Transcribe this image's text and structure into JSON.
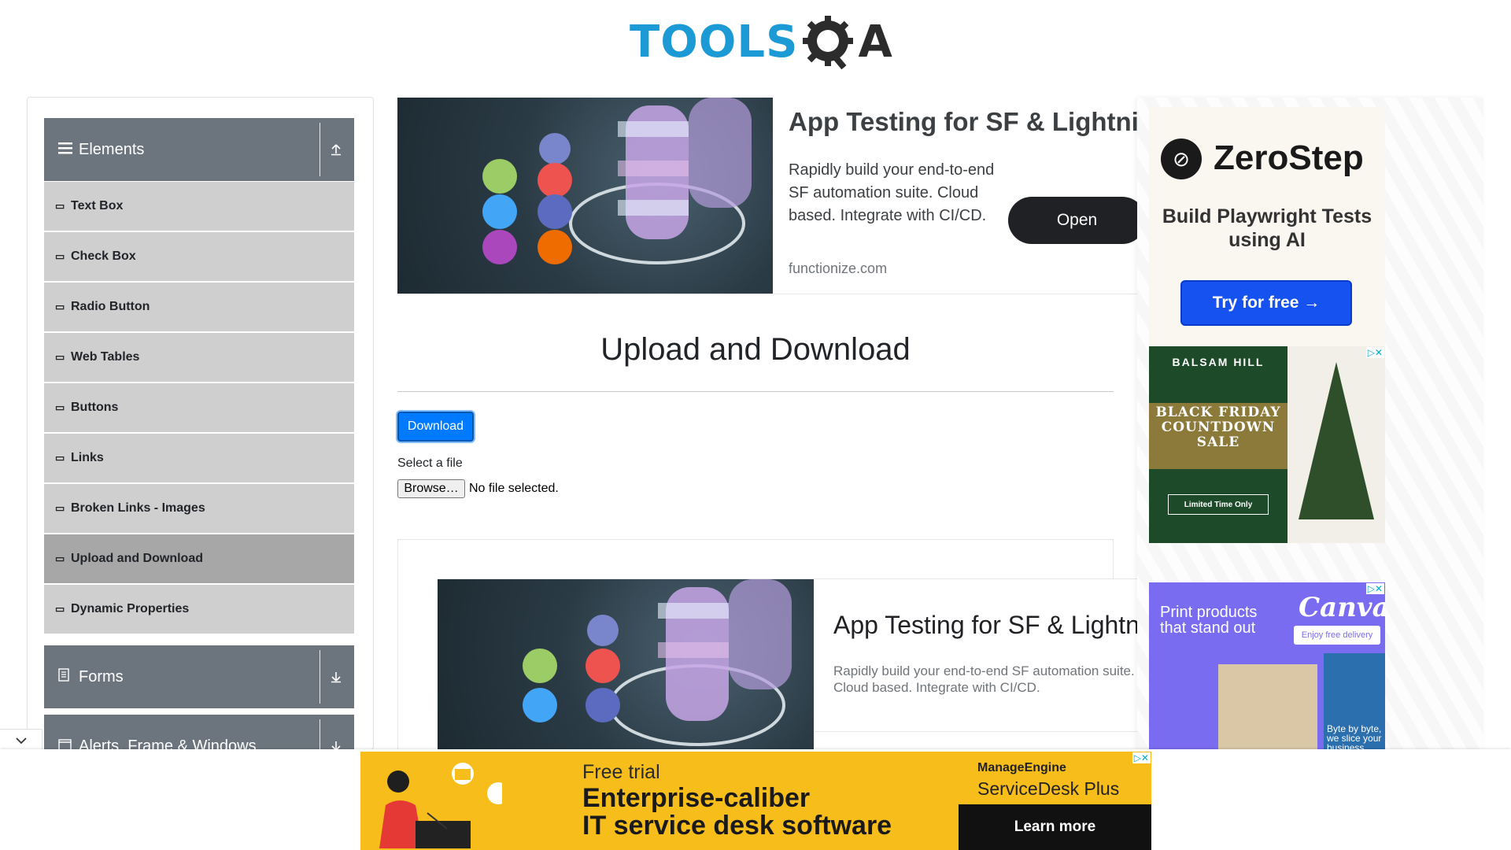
{
  "header": {
    "logo_tools": "TOOLS",
    "logo_qa": "A"
  },
  "sidebar": {
    "elements_group": {
      "label": "Elements",
      "icon": "hamburger-icon",
      "arrow": "collapse-up-icon"
    },
    "items": [
      {
        "label": "Text Box"
      },
      {
        "label": "Check Box"
      },
      {
        "label": "Radio Button"
      },
      {
        "label": "Web Tables"
      },
      {
        "label": "Buttons"
      },
      {
        "label": "Links"
      },
      {
        "label": "Broken Links - Images"
      },
      {
        "label": "Upload and Download",
        "active": true
      },
      {
        "label": "Dynamic Properties"
      }
    ],
    "forms_group": {
      "label": "Forms"
    },
    "alerts_group": {
      "label": "Alerts, Frame & Windows"
    }
  },
  "top_ad": {
    "title": "App Testing for SF & Lightning",
    "body": "Rapidly build your end-to-end SF automation suite. Cloud based. Integrate with CI/CD.",
    "domain": "functionize.com",
    "button": "Open"
  },
  "main": {
    "title": "Upload and Download",
    "download_label": "Download",
    "select_label": "Select a file",
    "browse_label": "Browse…",
    "file_status": "No file selected."
  },
  "mid_ad": {
    "title": "App Testing for SF & Lightning",
    "body": "Rapidly build your end-to-end SF automation suite. Cloud based. Integrate with CI/CD."
  },
  "right_ads": {
    "zerostep": {
      "name": "ZeroStep",
      "tagline": "Build Playwright Tests using AI",
      "button": "Try for free →"
    },
    "balsam": {
      "brand": "BALSAM HILL",
      "headline": "BLACK FRIDAY COUNTDOWN SALE",
      "cta": "Limited Time Only"
    },
    "canva": {
      "text": "Print products that stand out",
      "logo": "Canva",
      "cta": "Enjoy free delivery",
      "footer": "Byte by byte, we slice your business costs."
    }
  },
  "bottom_ad": {
    "eyebrow": "Free trial",
    "headline_line1": "Enterprise-caliber",
    "headline_line2": "IT service desk software",
    "brand": "ManageEngine",
    "product": "ServiceDesk Plus",
    "cta": "Learn more"
  },
  "colors": {
    "accent": "#007bff",
    "sidebar_group": "#6c757d",
    "sidebar_item": "#cfcfcf",
    "sidebar_active": "#a7a7a7",
    "logo_blue": "#1b9ad6"
  }
}
